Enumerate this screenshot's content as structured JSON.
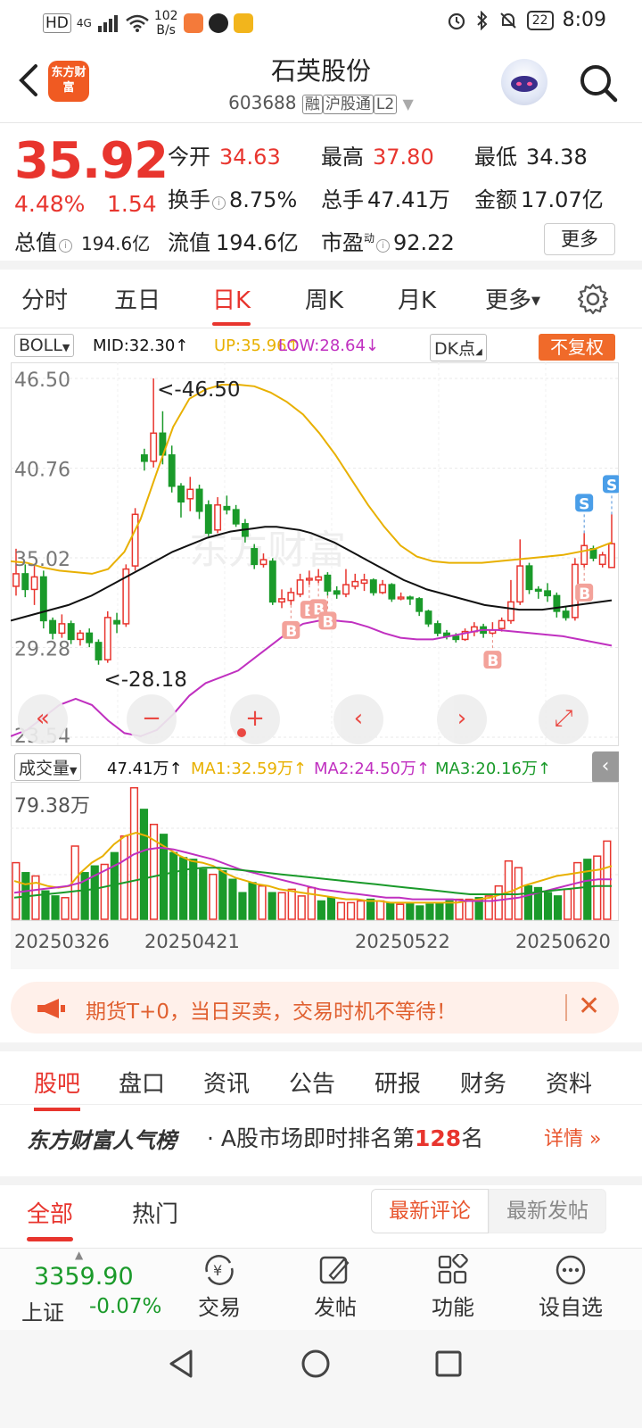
{
  "status": {
    "left_badges": [
      "HD",
      "4G"
    ],
    "net_speed_top": "102",
    "net_speed_bottom": "B/s",
    "battery": "22",
    "time": "8:09"
  },
  "header": {
    "logo_text": "东方财富",
    "title": "石英股份",
    "code": "603688",
    "tags": [
      "融",
      "沪股通",
      "L2"
    ]
  },
  "quote": {
    "price": "35.92",
    "change_pct": "4.48%",
    "change": "1.54",
    "rows": [
      [
        {
          "k": "今开",
          "v": "34.63",
          "c": "red"
        },
        {
          "k": "最高",
          "v": "37.80",
          "c": "red"
        },
        {
          "k": "最低",
          "v": "34.38",
          "c": "dark"
        }
      ],
      [
        {
          "k": "换手",
          "v": "8.75%",
          "c": "dark"
        },
        {
          "k": "总手",
          "v": "47.41万",
          "c": "dark"
        },
        {
          "k": "金额",
          "v": "17.07亿",
          "c": "dark"
        }
      ],
      [
        {
          "k": "总值",
          "v": "194.6亿",
          "c": "dark"
        },
        {
          "k": "流值",
          "v": "194.6亿",
          "c": "dark"
        },
        {
          "k": "市盈",
          "v": "92.22",
          "c": "dark"
        }
      ]
    ],
    "pe_sup": "动",
    "more": "更多"
  },
  "ktabs": [
    "分时",
    "五日",
    "日K",
    "周K",
    "月K",
    "更多"
  ],
  "indicator": {
    "name": "BOLL",
    "mid": "MID:32.30",
    "up": "UP:35.96",
    "low": "LOW:28.64",
    "dk": "DK点",
    "fq": "不复权"
  },
  "volume_indicator": {
    "name": "成交量",
    "vol": "47.41万",
    "ma1": "MA1:32.59万",
    "ma2": "MA2:24.50万",
    "ma3": "MA3:20.16万"
  },
  "colors": {
    "red": "#e8352e",
    "green": "#1a9a2a",
    "mid": "#111111",
    "up": "#e8b000",
    "low": "#c030c0",
    "accent": "#f06a2a"
  },
  "chart_data": [
    {
      "type": "candlestick",
      "yticks": [
        "46.50",
        "40.76",
        "35.02",
        "29.28",
        "23.54"
      ],
      "ylim": [
        23.54,
        46.5
      ],
      "high_label": "<-46.50",
      "low_label": "<-28.18",
      "markers": [
        "B",
        "B",
        "B",
        "B",
        "B",
        "B",
        "S",
        "S"
      ],
      "watermark": "东方财富",
      "candles": [
        [
          33.2,
          34.0,
          35.6,
          32.6
        ],
        [
          34.0,
          33.0,
          34.6,
          32.5
        ],
        [
          33.0,
          33.8,
          34.5,
          32.0
        ],
        [
          33.8,
          31.0,
          34.2,
          30.5
        ],
        [
          31.0,
          30.2,
          31.2,
          29.8
        ],
        [
          30.2,
          30.8,
          31.4,
          29.9
        ],
        [
          30.8,
          29.8,
          31.0,
          29.5
        ],
        [
          29.8,
          30.2,
          30.4,
          29.4
        ],
        [
          30.2,
          29.6,
          30.5,
          29.3
        ],
        [
          29.6,
          28.5,
          29.8,
          28.18
        ],
        [
          28.5,
          31.2,
          31.6,
          28.3
        ],
        [
          31.0,
          30.8,
          31.5,
          30.2
        ],
        [
          30.8,
          34.3,
          34.6,
          30.6
        ],
        [
          34.5,
          37.8,
          38.2,
          34.2
        ],
        [
          41.6,
          41.2,
          42.0,
          40.6
        ],
        [
          41.2,
          43.0,
          46.5,
          40.8
        ],
        [
          43.0,
          41.6,
          44.4,
          41.0
        ],
        [
          41.6,
          39.6,
          42.2,
          39.2
        ],
        [
          39.6,
          38.6,
          39.8,
          37.6
        ],
        [
          38.8,
          39.4,
          40.2,
          38.0
        ],
        [
          39.4,
          38.0,
          39.7,
          37.5
        ],
        [
          38.4,
          36.6,
          38.7,
          36.4
        ],
        [
          36.8,
          38.4,
          38.9,
          36.6
        ],
        [
          38.3,
          38.1,
          39.0,
          37.8
        ],
        [
          38.1,
          37.2,
          38.4,
          37.0
        ],
        [
          37.2,
          36.4,
          37.5,
          36.0
        ],
        [
          35.6,
          34.6,
          35.9,
          34.3
        ],
        [
          34.6,
          34.9,
          35.3,
          34.4
        ],
        [
          34.8,
          32.2,
          35.0,
          32.0
        ],
        [
          32.2,
          32.4,
          33.0,
          31.8
        ],
        [
          32.3,
          32.8,
          33.1,
          32.0
        ],
        [
          32.7,
          33.6,
          34.0,
          32.5
        ],
        [
          33.6,
          33.7,
          34.2,
          33.3
        ],
        [
          33.6,
          33.8,
          34.3,
          33.4
        ],
        [
          33.9,
          32.9,
          34.1,
          32.6
        ],
        [
          32.9,
          32.7,
          33.2,
          32.4
        ],
        [
          32.7,
          33.3,
          34.3,
          32.5
        ],
        [
          33.2,
          33.5,
          34.0,
          33.0
        ],
        [
          33.4,
          33.6,
          34.0,
          32.9
        ],
        [
          33.6,
          32.8,
          33.7,
          32.6
        ],
        [
          32.8,
          33.3,
          33.6,
          32.7
        ],
        [
          33.3,
          32.4,
          33.4,
          32.2
        ],
        [
          32.4,
          32.5,
          32.8,
          32.3
        ],
        [
          32.5,
          32.4,
          32.6,
          32.0
        ],
        [
          32.4,
          31.6,
          32.5,
          31.3
        ],
        [
          31.6,
          30.8,
          31.7,
          30.6
        ],
        [
          30.8,
          30.2,
          31.0,
          30.0
        ],
        [
          30.2,
          30.0,
          30.4,
          29.8
        ],
        [
          30.0,
          29.8,
          30.2,
          29.6
        ],
        [
          29.8,
          30.3,
          30.5,
          29.7
        ],
        [
          30.3,
          30.6,
          30.9,
          30.0
        ],
        [
          30.6,
          30.2,
          30.8,
          29.9
        ],
        [
          30.2,
          30.4,
          30.9,
          30.1
        ],
        [
          30.5,
          31.0,
          31.2,
          30.3
        ],
        [
          31.0,
          32.2,
          33.6,
          30.8
        ],
        [
          32.2,
          34.5,
          36.2,
          32.0
        ],
        [
          34.5,
          33.0,
          34.7,
          32.7
        ],
        [
          33.0,
          32.9,
          33.2,
          32.4
        ],
        [
          32.9,
          32.6,
          33.4,
          32.2
        ],
        [
          32.6,
          31.6,
          32.8,
          31.2
        ],
        [
          31.6,
          31.2,
          31.9,
          31.0
        ],
        [
          31.2,
          34.6,
          35.0,
          31.0
        ],
        [
          34.6,
          35.8,
          36.6,
          34.4
        ],
        [
          35.6,
          35.0,
          35.8,
          34.8
        ],
        [
          34.6,
          35.2,
          35.4,
          34.4
        ],
        [
          34.4,
          35.92,
          37.8,
          34.38
        ]
      ],
      "ma_mid": [
        31.0,
        31.2,
        31.4,
        31.6,
        31.8,
        32.0,
        32.3,
        32.6,
        33.0,
        33.4,
        33.8,
        34.2,
        34.6,
        35.0,
        35.4,
        35.7,
        36.0,
        36.3,
        36.5,
        36.7,
        36.8,
        36.9,
        37.0,
        37.0,
        36.9,
        36.8,
        36.6,
        36.3,
        36.0,
        35.6,
        35.2,
        34.8,
        34.4,
        34.0,
        33.6,
        33.3,
        33.0,
        32.8,
        32.6,
        32.4,
        32.2,
        32.0,
        31.9,
        31.8,
        31.7,
        31.7,
        31.7,
        31.8,
        31.9,
        32.0,
        32.1,
        32.2,
        32.3
      ],
      "ma_up": [
        34.8,
        34.7,
        34.4,
        34.2,
        34.1,
        34.0,
        34.3,
        35.4,
        37.5,
        40.5,
        43.4,
        45.2,
        45.8,
        46.1,
        46.1,
        46.0,
        45.6,
        45.0,
        44.2,
        43.0,
        41.6,
        40.0,
        38.4,
        37.0,
        35.8,
        35.1,
        34.8,
        34.7,
        34.7,
        34.7,
        34.8,
        34.9,
        35.0,
        35.1,
        35.2,
        35.4,
        35.6,
        36.0
      ],
      "ma_low": [
        23.6,
        24.0,
        24.8,
        25.6,
        26.0,
        25.6,
        24.6,
        23.8,
        23.6,
        24.0,
        25.0,
        26.2,
        27.0,
        27.4,
        27.8,
        28.6,
        29.4,
        30.2,
        30.8,
        31.0,
        31.0,
        30.9,
        30.6,
        30.2,
        29.9,
        29.8,
        29.8,
        30.0,
        30.2,
        30.4,
        30.4,
        30.3,
        30.2,
        30.1,
        30.0,
        29.8,
        29.6,
        29.4
      ]
    },
    {
      "type": "bar",
      "ylabel": "79.38万",
      "ylim": [
        0,
        79.38
      ],
      "xticks": [
        "20250326",
        "20250421",
        "20250522",
        "20250620"
      ],
      "values": [
        34,
        28,
        26,
        17,
        14,
        13,
        44,
        28,
        32,
        33,
        40,
        50,
        79,
        66,
        57,
        51,
        40,
        37,
        36,
        30,
        27,
        29,
        24,
        16,
        22,
        20,
        16,
        16,
        18,
        14,
        19,
        11,
        13,
        10,
        10,
        11,
        12,
        11,
        10,
        9,
        10,
        8,
        9,
        10,
        11,
        12,
        12,
        13,
        14,
        20,
        35,
        31,
        20,
        19,
        16,
        14,
        18,
        34,
        36,
        38,
        47
      ],
      "ma1": [
        23,
        21,
        22,
        20,
        19,
        20,
        28,
        34,
        38,
        45,
        50,
        52,
        50,
        46,
        42,
        38,
        35,
        34,
        32,
        28,
        25,
        23,
        21,
        20,
        18,
        17,
        16,
        15,
        14,
        13,
        12,
        12,
        11,
        11,
        10,
        10,
        10,
        10,
        10,
        10,
        10,
        11,
        12,
        13,
        15,
        17,
        20,
        22,
        24,
        26,
        27,
        28,
        29,
        30,
        32
      ],
      "ma2": [
        16,
        17,
        18,
        19,
        20,
        22,
        26,
        30,
        34,
        39,
        42,
        43,
        42,
        40,
        38,
        36,
        33,
        30,
        28,
        26,
        24,
        22,
        20,
        18,
        17,
        16,
        15,
        14,
        13,
        13,
        12,
        12,
        12,
        12,
        11,
        11,
        11,
        12,
        13,
        15,
        17,
        19,
        21,
        23,
        24,
        24
      ],
      "ma3": [
        13,
        14,
        15,
        16,
        17,
        18,
        20,
        22,
        24,
        26,
        28,
        30,
        31,
        31,
        30,
        29,
        28,
        27,
        26,
        25,
        24,
        23,
        22,
        21,
        20,
        19,
        18,
        17,
        16,
        15,
        15,
        15,
        15,
        16,
        17,
        18,
        19,
        20,
        20
      ]
    }
  ],
  "ad": {
    "text": "期货T+0，当日买卖，交易时机不等待！"
  },
  "section_tabs": [
    "股吧",
    "盘口",
    "资讯",
    "公告",
    "研报",
    "财务",
    "资料"
  ],
  "rank": {
    "brand": "东方财富人气榜",
    "prefix": "A股市场即时排名第",
    "num": "128",
    "suffix": "名",
    "detail": "详情"
  },
  "feed_tabs": [
    "全部",
    "热门"
  ],
  "sort_tabs": [
    "最新评论",
    "最新发帖"
  ],
  "bottom_nav": {
    "index_value": "3359.90",
    "index_name": "上证",
    "index_change": "-0.07%",
    "items": [
      "交易",
      "发帖",
      "功能",
      "设自选"
    ]
  }
}
